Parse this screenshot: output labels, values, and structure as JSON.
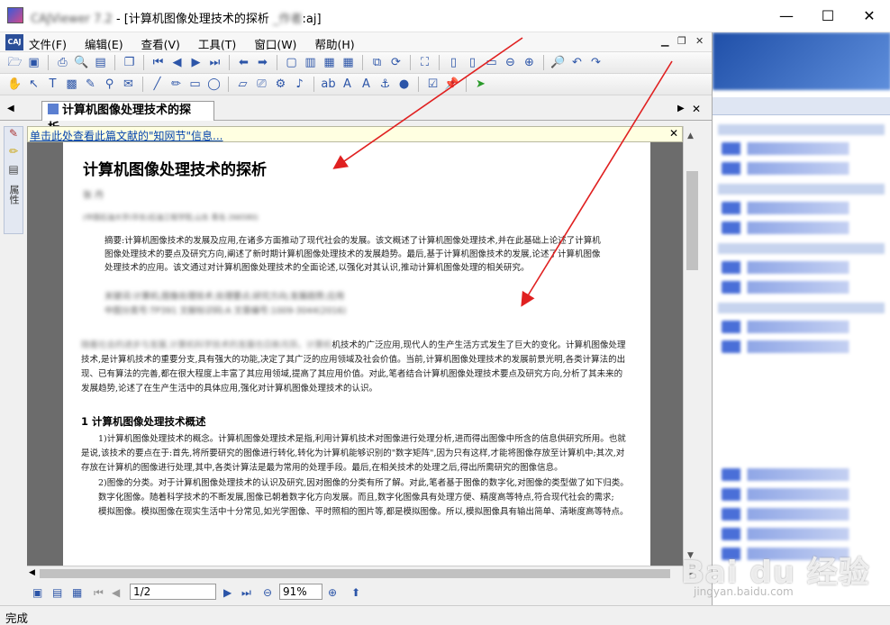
{
  "window": {
    "app_name_blurred": "CAJViewer 7.2",
    "title": " - [计算机图像处理技术的探析",
    "title_tail_blurred": "_作者",
    "title_ext": ":aj]",
    "minimize": "—",
    "maximize": "☐",
    "close": "✕"
  },
  "menu": {
    "items": [
      "文件(F)",
      "编辑(E)",
      "查看(V)",
      "工具(T)",
      "窗口(W)",
      "帮助(H)"
    ],
    "mdi_min": "▁",
    "mdi_restore": "❐",
    "mdi_close": "✕"
  },
  "tab": {
    "title": "计算机图像处理技术的探析...",
    "left_arrow": "◀",
    "right_arrow": "▶",
    "close": "✕"
  },
  "left_tools": {
    "side_label": "属性"
  },
  "infobar": {
    "link": "单击此处查看此篇文献的\"知网节\"信息...",
    "close": "✕"
  },
  "document": {
    "title": "计算机图像处理技术的探析",
    "author_blurred": "张 丹",
    "affiliation_blurred": "(中国石油大学(华东)石油工程学院,山东 青岛 266580)",
    "abstract": "摘要:计算机图像技术的发展及应用,在诸多方面推动了现代社会的发展。该文概述了计算机图像处理技术,并在此基础上论述了计算机图像处理技术的要点及研究方向,阐述了新时期计算机图像处理技术的发展趋势。最后,基于计算机图像技术的发展,论述了计算机图像处理技术的应用。该文通过对计算机图像处理技术的全面论述,以强化对其认识,推动计算机图像处理的相关研究。",
    "keywords_blurred": "关键词:计算机;图像处理技术;处理要点;研究方向;发展趋势;应用",
    "meta_blurred": "中图分类号:TP391 文献标识码:A 文章编号:1009-3044(2016)",
    "intro_blurred": "随着社会的进步与发展,计算机科学技术的发展也日新月异。计算机",
    "intro": "机技术的广泛应用,现代人的生产生活方式发生了巨大的变化。计算机图像处理技术,是计算机技术的重要分支,具有强大的功能,决定了其广泛的应用领域及社会价值。当前,计算机图像处理技术的发展前景光明,各类计算法的出现、已有算法的完善,都在很大程度上丰富了其应用领域,提高了其应用价值。对此,笔者结合计算机图像处理技术要点及研究方向,分析了其未来的发展趋势,论述了在生产生活中的具体应用,强化对计算机图像处理技术的认识。",
    "heading1": "1 计算机图像处理技术概述",
    "p1": "1)计算机图像处理技术的概念。计算机图像处理技术是指,利用计算机技术对图像进行处理分析,进而得出图像中所含的信息供研究所用。也就是说,该技术的要点在于:首先,将所要研究的图像进行转化,转化为计算机能够识别的\"数字矩阵\",因为只有这样,才能将图像存放至计算机中;其次,对存放在计算机的图像进行处理,其中,各类计算法是最为常用的处理手段。最后,在相关技术的处理之后,得出所需研究的图像信息。",
    "p2": "2)图像的分类。对于计算机图像处理技术的认识及研究,因对图像的分类有所了解。对此,笔者基于图像的数字化,对图像的类型做了如下归类。",
    "p3": "数字化图像。随着科学技术的不断发展,图像已朝着数字化方向发展。而且,数字化图像具有处理方便、精度高等特点,符合现代社会的需求;",
    "p4": "模拟图像。模拟图像在现实生活中十分常见,如光学图像、平时照相的图片等,都是模拟图像。所以,模拟图像具有输出简单、清晰度高等特点。"
  },
  "navbar": {
    "page": "1/2",
    "zoom": "91%"
  },
  "status": {
    "text": "完成"
  },
  "watermark": {
    "brand": "Bai du 经验",
    "url": "jingyan.baidu.com"
  },
  "colors": {
    "arrow": "#e02020",
    "link": "#0645ad",
    "infobar": "#ffffe1"
  }
}
